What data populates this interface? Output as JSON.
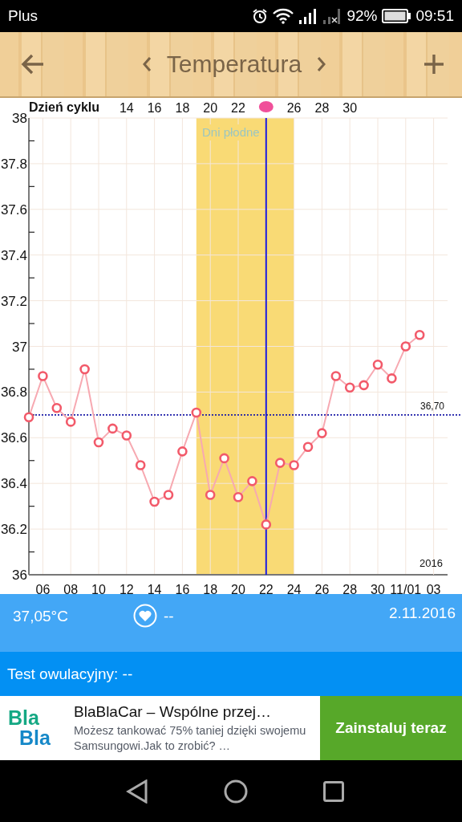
{
  "status_bar": {
    "carrier": "Plus",
    "battery": "92%",
    "time": "09:51"
  },
  "header": {
    "title": "Temperatura"
  },
  "chart": {
    "cycle_axis": {
      "label": "Dzień cyklu",
      "ticks": [
        {
          "kind": "text",
          "label": "14"
        },
        {
          "kind": "text",
          "label": "16"
        },
        {
          "kind": "text",
          "label": "18"
        },
        {
          "kind": "text",
          "label": "20"
        },
        {
          "kind": "text",
          "label": "22"
        },
        {
          "kind": "marker"
        },
        {
          "kind": "text",
          "label": "26"
        },
        {
          "kind": "text",
          "label": "28"
        },
        {
          "kind": "text",
          "label": "30"
        }
      ]
    },
    "year_label": "2016",
    "last_date_tick": {
      "label": "03"
    },
    "chart_data": {
      "type": "line",
      "grid": true,
      "xlim": [
        5,
        35
      ],
      "ylim": [
        36,
        38
      ],
      "x": [
        5,
        6,
        7,
        8,
        9,
        10,
        11,
        12,
        13,
        14,
        15,
        16,
        17,
        18,
        19,
        20,
        21,
        22,
        23,
        24,
        25,
        26,
        27,
        28,
        29,
        30,
        31,
        32,
        33
      ],
      "series": [
        {
          "color": "#f25a6a",
          "marker": "circle",
          "values": [
            36.69,
            36.87,
            36.73,
            36.67,
            36.9,
            36.58,
            36.64,
            36.61,
            36.48,
            36.32,
            36.35,
            36.54,
            36.71,
            36.35,
            36.51,
            36.34,
            36.41,
            36.22,
            36.49,
            36.48,
            36.56,
            36.62,
            36.87,
            36.82,
            36.83,
            36.92,
            36.86,
            37.0,
            37.05
          ]
        }
      ],
      "xticks": [
        {
          "value": 6,
          "label": "06"
        },
        {
          "value": 8,
          "label": "08"
        },
        10,
        12,
        14,
        16,
        18,
        20,
        22,
        24,
        26,
        28,
        30,
        {
          "value": 32,
          "label": "11/01"
        }
      ],
      "yticks": [
        {
          "value": 36,
          "label": "36"
        },
        {
          "value": 36.2,
          "label": "36.2"
        },
        {
          "value": 36.4,
          "label": "36.4"
        },
        {
          "value": 36.6,
          "label": "36.6"
        },
        {
          "value": 36.8,
          "label": "36.8"
        },
        {
          "value": 37,
          "label": "37"
        },
        {
          "value": 37.2,
          "label": "37.2"
        },
        {
          "value": 37.4,
          "label": "37.4"
        },
        {
          "value": 37.6,
          "label": "37.6"
        },
        {
          "value": 37.8,
          "label": "37.8"
        },
        {
          "value": 38,
          "label": "38"
        }
      ],
      "bands": [
        {
          "axis": "x",
          "from": 17,
          "to": 24,
          "label": "Dni płodne"
        }
      ],
      "ref_lines": [
        {
          "axis": "x",
          "value": 22
        },
        {
          "axis": "y",
          "value": 36.7,
          "label": "36,70"
        }
      ]
    }
  },
  "reading": {
    "temperature": "37,05°C",
    "heart_value": "--",
    "date": "2.11.2016"
  },
  "ovulation_test": {
    "label": "Test owulacyjny: --"
  },
  "ad": {
    "logo_lines": [
      "Bla",
      "Bla"
    ],
    "title": "BlaBlaCar – Wspólne przej…",
    "text": "Możesz tankować 75% taniej dzięki swojemu Samsungowi.Jak to zrobić? …",
    "button": "Zainstaluj teraz"
  }
}
